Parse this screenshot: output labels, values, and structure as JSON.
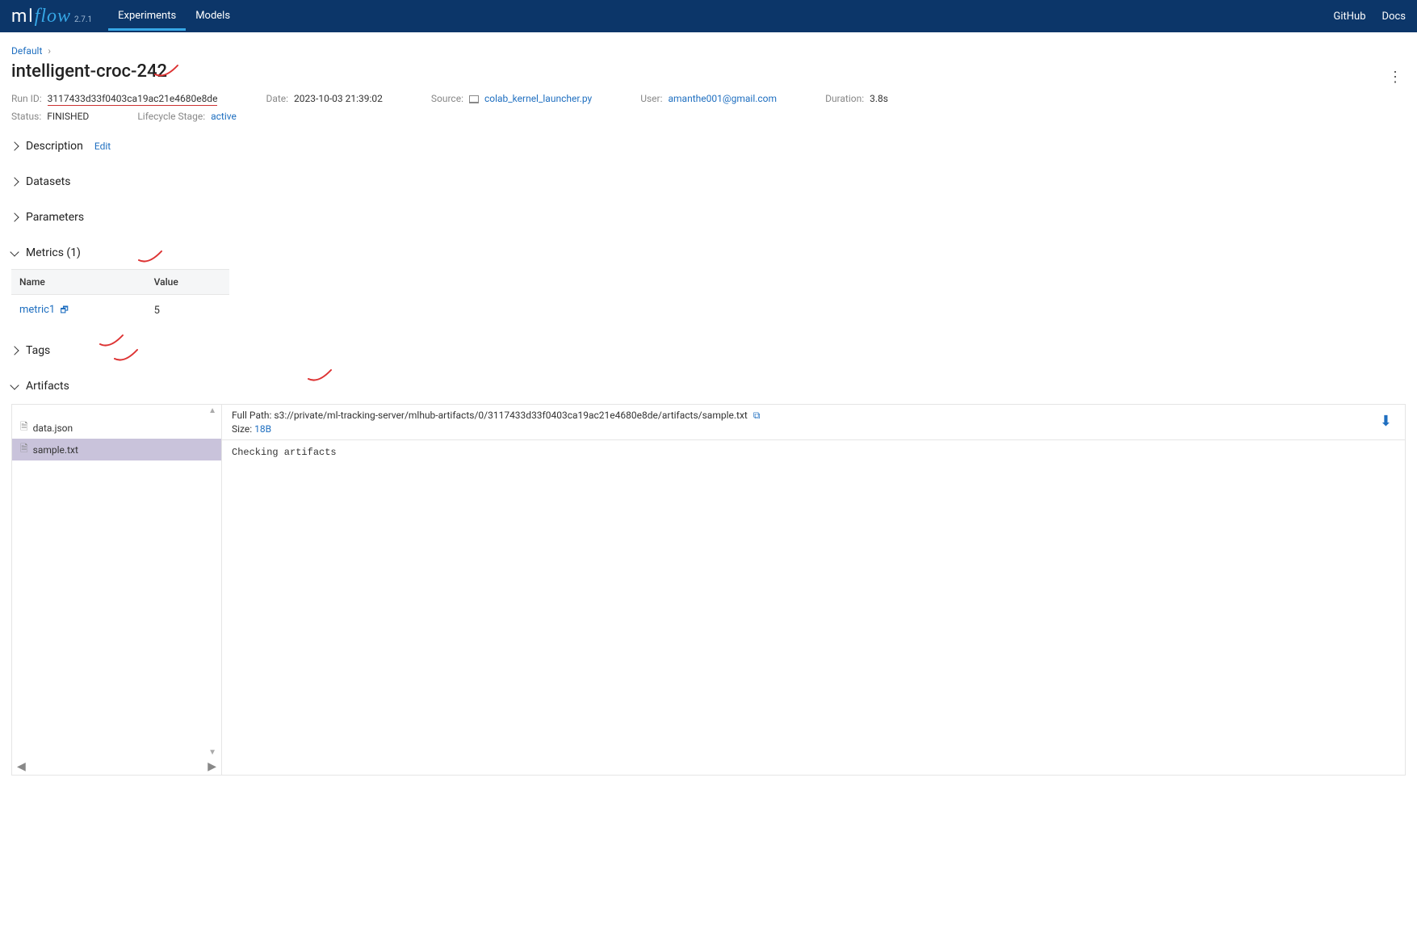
{
  "header": {
    "logo_ml": "ml",
    "logo_flow": "flow",
    "version": "2.7.1",
    "nav_experiments": "Experiments",
    "nav_models": "Models",
    "nav_github": "GitHub",
    "nav_docs": "Docs"
  },
  "breadcrumb": {
    "root": "Default"
  },
  "run": {
    "title": "intelligent-croc-242",
    "run_id_label": "Run ID:",
    "run_id": "3117433d33f0403ca19ac21e4680e8de",
    "date_label": "Date:",
    "date": "2023-10-03 21:39:02",
    "source_label": "Source:",
    "source": "colab_kernel_launcher.py",
    "user_label": "User:",
    "user": "amanthe001@gmail.com",
    "duration_label": "Duration:",
    "duration": "3.8s",
    "status_label": "Status:",
    "status": "FINISHED",
    "lifecycle_label": "Lifecycle Stage:",
    "lifecycle": "active"
  },
  "sections": {
    "description": "Description",
    "description_edit": "Edit",
    "datasets": "Datasets",
    "parameters": "Parameters",
    "metrics": "Metrics (1)",
    "tags": "Tags",
    "artifacts": "Artifacts"
  },
  "metrics": {
    "col_name": "Name",
    "col_value": "Value",
    "rows": [
      {
        "name": "metric1",
        "value": "5"
      }
    ]
  },
  "artifacts": {
    "tree": [
      {
        "name": "data.json",
        "selected": false
      },
      {
        "name": "sample.txt",
        "selected": true
      }
    ],
    "full_path_label": "Full Path:",
    "full_path": "s3://private/ml-tracking-server/mlhub-artifacts/0/3117433d33f0403ca19ac21e4680e8de/artifacts/sample.txt",
    "size_label": "Size:",
    "size": "18B",
    "preview_text": "Checking artifacts"
  }
}
